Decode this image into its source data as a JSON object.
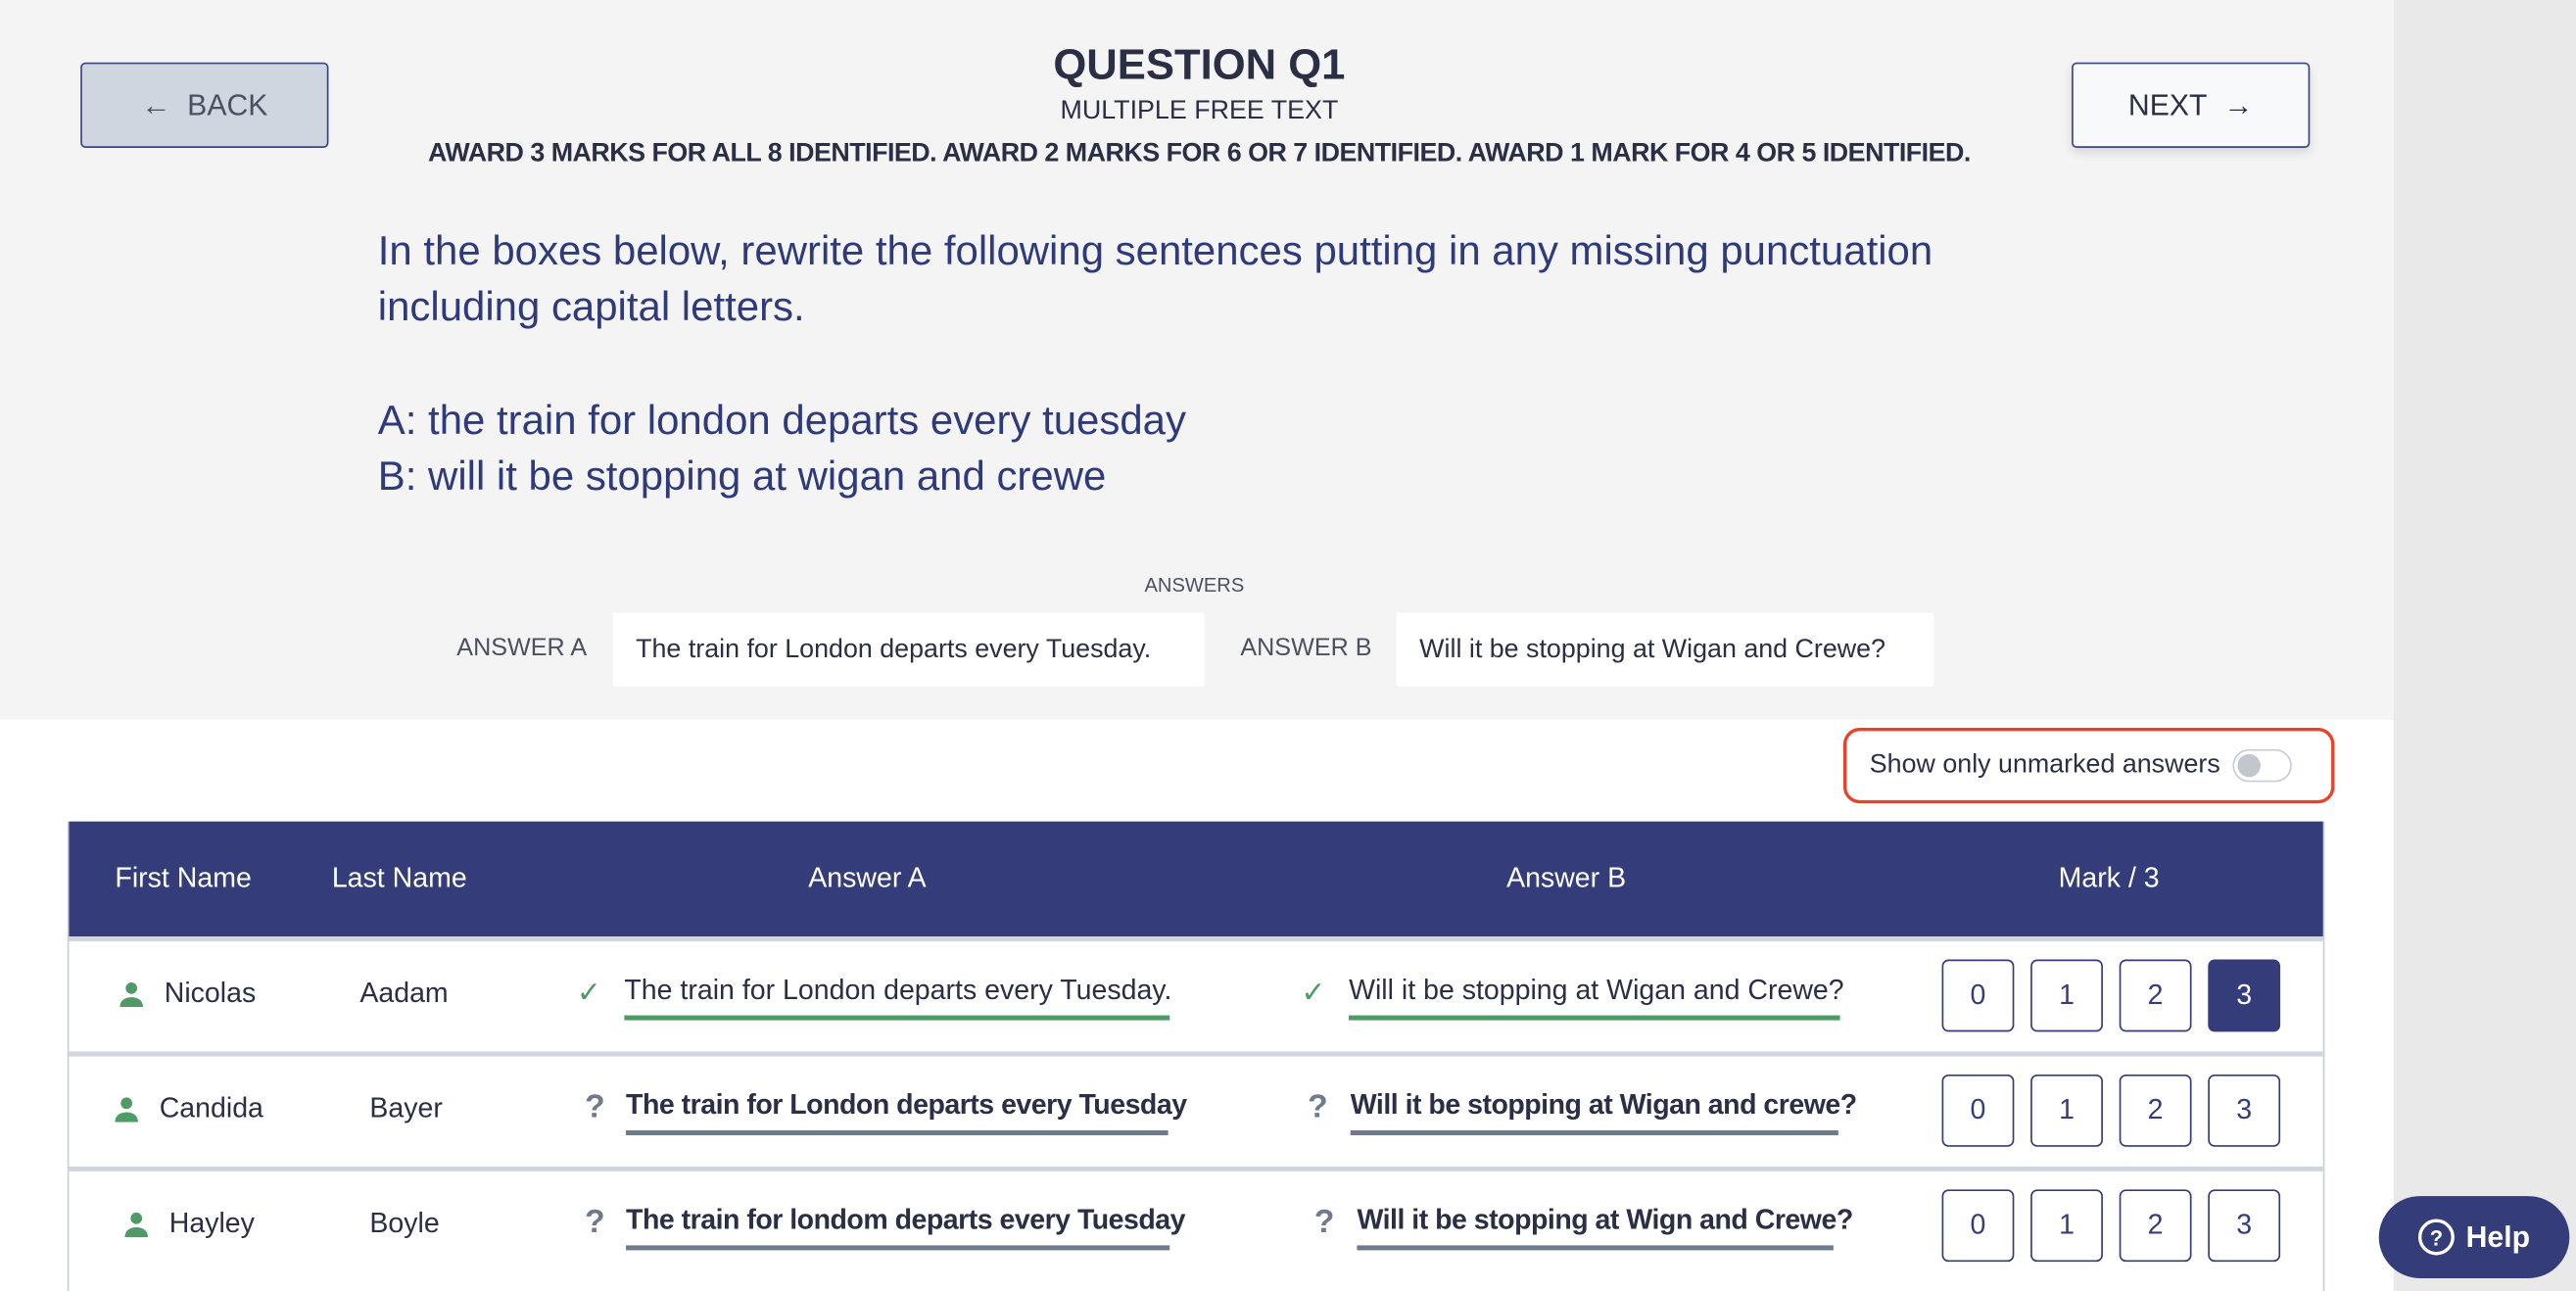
{
  "colors": {
    "primary": "#343d7a",
    "correct": "#4f9a66",
    "highlight": "#e8432a"
  },
  "nav": {
    "back_label": "BACK",
    "next_label": "NEXT",
    "back_icon": "arrow-left-icon",
    "next_icon": "arrow-right-icon"
  },
  "header": {
    "title": "QUESTION Q1",
    "subtitle": "MULTIPLE FREE TEXT",
    "award": "AWARD 3 MARKS FOR ALL 8 IDENTIFIED. AWARD 2 MARKS FOR 6 OR 7 IDENTIFIED. AWARD 1 MARK FOR 4 OR 5 IDENTIFIED."
  },
  "question": {
    "line1": "In the boxes below, rewrite the following sentences putting in any missing punctuation",
    "line2": "including capital letters.",
    "line3": "A: the train for london departs every tuesday",
    "line4": "B: will it be stopping at wigan and crewe"
  },
  "answers": {
    "label": "ANSWERS",
    "a_label": "ANSWER A",
    "a_value": "The train for London departs every Tuesday.",
    "b_label": "ANSWER B",
    "b_value": "Will it be stopping at Wigan and Crewe?"
  },
  "filter": {
    "label": "Show only unmarked answers",
    "enabled": false
  },
  "table": {
    "headers": [
      "First Name",
      "Last Name",
      "Answer A",
      "Answer B",
      "Mark / 3"
    ],
    "marks": [
      "0",
      "1",
      "2",
      "3"
    ],
    "rows": [
      {
        "first": "Nicolas",
        "last": "Aadam",
        "a": "The train for London departs every Tuesday.",
        "a_status": "correct",
        "b": "Will it be stopping at Wigan and Crewe?",
        "b_status": "correct",
        "mark": "3"
      },
      {
        "first": "Candida",
        "last": "Bayer",
        "a": "The train for London departs every Tuesday",
        "a_status": "unmarked",
        "b": "Will it be stopping at Wigan and crewe?",
        "b_status": "unmarked",
        "mark": null
      },
      {
        "first": "Hayley",
        "last": "Boyle",
        "a": "The train for londom departs every Tuesday",
        "a_status": "unmarked",
        "b": "Will it be stopping at Wign and Crewe?",
        "b_status": "unmarked",
        "mark": null
      }
    ]
  },
  "help": {
    "label": "Help",
    "icon": "question-circle-icon"
  }
}
